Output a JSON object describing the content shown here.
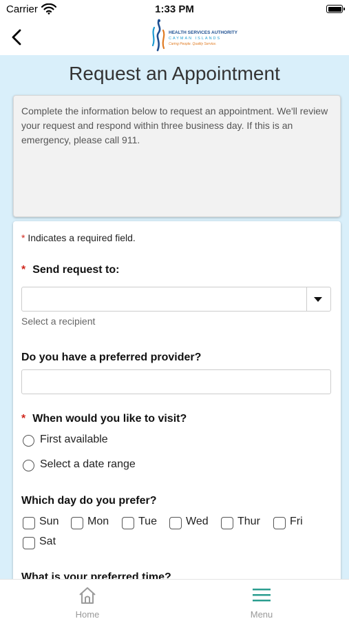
{
  "status_bar": {
    "carrier": "Carrier",
    "time": "1:33 PM"
  },
  "header": {
    "logo": {
      "line1": "HEALTH SERVICES AUTHORITY",
      "line2": "CAYMAN ISLANDS",
      "line3": "Caring People. Quality Service."
    }
  },
  "page": {
    "title": "Request an Appointment"
  },
  "intro": {
    "text": "Complete the information below to request an appointment. We'll review your request and respond within three business day. If this is an emergency, please call 911."
  },
  "form": {
    "required_marker": "*",
    "required_note": "Indicates a required field.",
    "send_to": {
      "label": "Send request to:",
      "value": "",
      "helper": "Select a recipient"
    },
    "provider": {
      "label": "Do you have a preferred provider?",
      "value": "",
      "placeholder": ""
    },
    "visit": {
      "label": "When would you like to visit?",
      "options": [
        {
          "label": "First available"
        },
        {
          "label": "Select a date range"
        }
      ]
    },
    "days": {
      "label": "Which day do you prefer?",
      "options": [
        {
          "label": "Sun"
        },
        {
          "label": "Mon"
        },
        {
          "label": "Tue"
        },
        {
          "label": "Wed"
        },
        {
          "label": "Thur"
        },
        {
          "label": "Fri"
        },
        {
          "label": "Sat"
        }
      ]
    },
    "time": {
      "label": "What is your preferred time?"
    }
  },
  "tabs": [
    {
      "label": "Home",
      "icon": "home-icon"
    },
    {
      "label": "Menu",
      "icon": "menu-icon"
    }
  ],
  "colors": {
    "background": "#d9effa",
    "required": "#d0271d",
    "menu_accent": "#2a9d8f"
  }
}
